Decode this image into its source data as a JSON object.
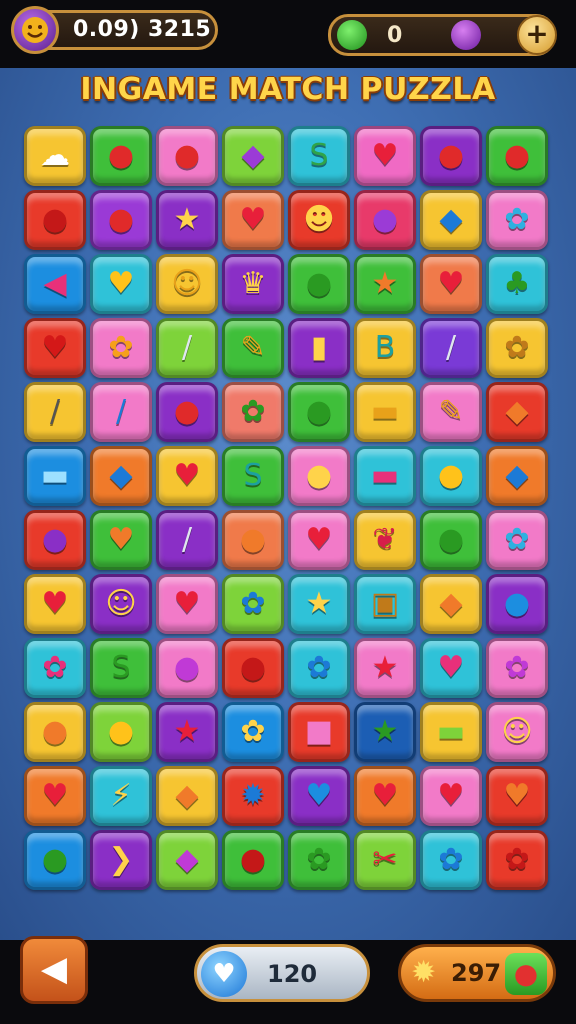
{
  "header": {
    "avatar_icon": "smiley-face-icon",
    "score_text": "0.09) 3215",
    "gems_count": "0",
    "gem_icons": [
      "green-gem-icon",
      "purple-gem-icon"
    ],
    "add_label": "+"
  },
  "title": "INGAME MATCH PUZZLA",
  "grid": {
    "columns": 8,
    "rows": [
      [
        {
          "color": "#f6c531",
          "icon": "☁",
          "ic": "#ffffff",
          "name": "cloud-face-icon"
        },
        {
          "color": "#3fbf3a",
          "icon": "●",
          "ic": "#e02a2a",
          "name": "apple-icon"
        },
        {
          "color": "#f27ac8",
          "icon": "●",
          "ic": "#e02a2a",
          "name": "apple-icon"
        },
        {
          "color": "#7ed33a",
          "icon": "◆",
          "ic": "#9b3bd6",
          "name": "block-icon"
        },
        {
          "color": "#2fc2d8",
          "icon": "S",
          "ic": "#2fa34a",
          "name": "worm-icon"
        },
        {
          "color": "#f06ac4",
          "icon": "♥",
          "ic": "#e81f3a",
          "name": "heart-icon"
        },
        {
          "color": "#8a2fc6",
          "icon": "●",
          "ic": "#e02a2a",
          "name": "apple-icon"
        },
        {
          "color": "#3fbf3a",
          "icon": "●",
          "ic": "#e02a2a",
          "name": "ball-icon"
        }
      ],
      [
        {
          "color": "#e83a2a",
          "icon": "●",
          "ic": "#c41818",
          "name": "apple-icon"
        },
        {
          "color": "#9a3ad6",
          "icon": "●",
          "ic": "#e02a2a",
          "name": "apple-icon"
        },
        {
          "color": "#8a2fc6",
          "icon": "★",
          "ic": "#ffd34a",
          "name": "star-icon"
        },
        {
          "color": "#f07a4a",
          "icon": "♥",
          "ic": "#e81f3a",
          "name": "heart-icon"
        },
        {
          "color": "#e83a2a",
          "icon": "☻",
          "ic": "#ffd34a",
          "name": "face-icon"
        },
        {
          "color": "#e83a6a",
          "icon": "●",
          "ic": "#9b3bd6",
          "name": "apple-icon"
        },
        {
          "color": "#f6c531",
          "icon": "◆",
          "ic": "#1c7ad6",
          "name": "pencil-icon"
        },
        {
          "color": "#f27ac8",
          "icon": "✿",
          "ic": "#2fb0e0",
          "name": "flower-icon"
        }
      ],
      [
        {
          "color": "#1c8ee0",
          "icon": "◀",
          "ic": "#e8307a",
          "name": "arrow-icon"
        },
        {
          "color": "#2fc2d8",
          "icon": "♥",
          "ic": "#ffc21a",
          "name": "heart-icon"
        },
        {
          "color": "#f6c531",
          "icon": "☺",
          "ic": "#e8a11a",
          "name": "smiley-icon"
        },
        {
          "color": "#8a2fc6",
          "icon": "♛",
          "ic": "#ffd34a",
          "name": "crown-icon"
        },
        {
          "color": "#3fbf3a",
          "icon": "●",
          "ic": "#2a9a22",
          "name": "apple-icon"
        },
        {
          "color": "#3fbf3a",
          "icon": "★",
          "ic": "#f07a2a",
          "name": "star-icon"
        },
        {
          "color": "#f07a4a",
          "icon": "♥",
          "ic": "#e81f3a",
          "name": "heart-icon"
        },
        {
          "color": "#2fc2d8",
          "icon": "♣",
          "ic": "#2a9a22",
          "name": "tree-icon"
        }
      ],
      [
        {
          "color": "#e83a2a",
          "icon": "♥",
          "ic": "#d41818",
          "name": "heart-icon"
        },
        {
          "color": "#f27ac8",
          "icon": "✿",
          "ic": "#f6a01a",
          "name": "gear-icon"
        },
        {
          "color": "#7ed33a",
          "icon": "/",
          "ic": "#dfe6ee",
          "name": "crayon-icon"
        },
        {
          "color": "#3fbf3a",
          "icon": "✎",
          "ic": "#e8a11a",
          "name": "brush-icon"
        },
        {
          "color": "#8a2fc6",
          "icon": "▮",
          "ic": "#ffd34a",
          "name": "crayon-icon"
        },
        {
          "color": "#f6c531",
          "icon": "B",
          "ic": "#1ca0a0",
          "name": "block-icon"
        },
        {
          "color": "#7a3ad6",
          "icon": "/",
          "ic": "#dfe6ee",
          "name": "crayon-icon"
        },
        {
          "color": "#f6c531",
          "icon": "✿",
          "ic": "#c07a1a",
          "name": "gear-icon"
        }
      ],
      [
        {
          "color": "#f6c531",
          "icon": "/",
          "ic": "#555555",
          "name": "crayon-icon"
        },
        {
          "color": "#f27ac8",
          "icon": "/",
          "ic": "#1c7ad6",
          "name": "crayon-icon"
        },
        {
          "color": "#8a2fc6",
          "icon": "●",
          "ic": "#e02a2a",
          "name": "blob-icon"
        },
        {
          "color": "#f07a6a",
          "icon": "✿",
          "ic": "#2a9a22",
          "name": "splat-icon"
        },
        {
          "color": "#3fbf3a",
          "icon": "●",
          "ic": "#2a9a22",
          "name": "blob-icon"
        },
        {
          "color": "#f6c531",
          "icon": "▬",
          "ic": "#e8a11a",
          "name": "eraser-icon"
        },
        {
          "color": "#f27ac8",
          "icon": "✎",
          "ic": "#e8a11a",
          "name": "pencil-icon"
        },
        {
          "color": "#e83a2a",
          "icon": "◆",
          "ic": "#f07a2a",
          "name": "leaf-icon"
        }
      ],
      [
        {
          "color": "#1c8ee0",
          "icon": "▬",
          "ic": "#9ee0ff",
          "name": "eraser-icon"
        },
        {
          "color": "#f07a2a",
          "icon": "◆",
          "ic": "#1c7ad6",
          "name": "diamond-icon"
        },
        {
          "color": "#f6c531",
          "icon": "♥",
          "ic": "#e81f3a",
          "name": "heart-icon"
        },
        {
          "color": "#3fbf3a",
          "icon": "S",
          "ic": "#1ca0a0",
          "name": "worm-icon"
        },
        {
          "color": "#f27ac8",
          "icon": "●",
          "ic": "#ffd34a",
          "name": "hexagon-icon"
        },
        {
          "color": "#2fc2d8",
          "icon": "▬",
          "ic": "#e8307a",
          "name": "ruler-icon"
        },
        {
          "color": "#2fc2d8",
          "icon": "●",
          "ic": "#ffc21a",
          "name": "ball-icon"
        },
        {
          "color": "#f07a2a",
          "icon": "◆",
          "ic": "#1c7ad6",
          "name": "diamond-icon"
        }
      ],
      [
        {
          "color": "#e83a2a",
          "icon": "●",
          "ic": "#8a2fc6",
          "name": "blob-icon"
        },
        {
          "color": "#3fbf3a",
          "icon": "♥",
          "ic": "#f07a2a",
          "name": "heart-icon"
        },
        {
          "color": "#8a2fc6",
          "icon": "/",
          "ic": "#dfe6ee",
          "name": "crayon-icon"
        },
        {
          "color": "#f07a4a",
          "icon": "●",
          "ic": "#f07a2a",
          "name": "blob-icon"
        },
        {
          "color": "#f27ac8",
          "icon": "♥",
          "ic": "#e81f3a",
          "name": "heart-icon"
        },
        {
          "color": "#f6c531",
          "icon": "❦",
          "ic": "#d61e4a",
          "name": "strawberry-icon"
        },
        {
          "color": "#3fbf3a",
          "icon": "●",
          "ic": "#2a9a22",
          "name": "apple-icon"
        },
        {
          "color": "#f27ac8",
          "icon": "✿",
          "ic": "#2fb0e0",
          "name": "flower-icon"
        }
      ],
      [
        {
          "color": "#f6c531",
          "icon": "♥",
          "ic": "#e81f3a",
          "name": "heart-icon"
        },
        {
          "color": "#8a2fc6",
          "icon": "☺",
          "ic": "#ffd34a",
          "name": "smiley-icon"
        },
        {
          "color": "#f27ac8",
          "icon": "♥",
          "ic": "#e81f3a",
          "name": "heart-icon"
        },
        {
          "color": "#7ed33a",
          "icon": "✿",
          "ic": "#1c7ad6",
          "name": "flower-icon"
        },
        {
          "color": "#2fc2d8",
          "icon": "★",
          "ic": "#ffd34a",
          "name": "house-icon"
        },
        {
          "color": "#2fc2d8",
          "icon": "▣",
          "ic": "#c07a1a",
          "name": "robot-icon"
        },
        {
          "color": "#f6c531",
          "icon": "◆",
          "ic": "#f07a2a",
          "name": "carrot-icon"
        },
        {
          "color": "#8a2fc6",
          "icon": "●",
          "ic": "#1c8ee0",
          "name": "ball-icon"
        }
      ],
      [
        {
          "color": "#2fc2d8",
          "icon": "✿",
          "ic": "#e8307a",
          "name": "flower-icon"
        },
        {
          "color": "#3fbf3a",
          "icon": "S",
          "ic": "#2a9a22",
          "name": "worm-icon"
        },
        {
          "color": "#f27ac8",
          "icon": "●",
          "ic": "#c03ad6",
          "name": "blob-icon"
        },
        {
          "color": "#e83a2a",
          "icon": "●",
          "ic": "#c41818",
          "name": "apple-icon"
        },
        {
          "color": "#2fc2d8",
          "icon": "✿",
          "ic": "#1c7ad6",
          "name": "gear-icon"
        },
        {
          "color": "#f27ac8",
          "icon": "★",
          "ic": "#e81f3a",
          "name": "star-icon"
        },
        {
          "color": "#2fc2d8",
          "icon": "♥",
          "ic": "#e8307a",
          "name": "heart-icon"
        },
        {
          "color": "#f27ac8",
          "icon": "✿",
          "ic": "#c03ad6",
          "name": "flower-icon"
        }
      ],
      [
        {
          "color": "#f6c531",
          "icon": "●",
          "ic": "#f07a2a",
          "name": "orange-icon"
        },
        {
          "color": "#7ed33a",
          "icon": "●",
          "ic": "#ffc21a",
          "name": "ball-icon"
        },
        {
          "color": "#8a2fc6",
          "icon": "★",
          "ic": "#e81f3a",
          "name": "star-icon"
        },
        {
          "color": "#1c8ee0",
          "icon": "✿",
          "ic": "#ffd34a",
          "name": "gear-icon"
        },
        {
          "color": "#e83a2a",
          "icon": "■",
          "ic": "#f27ac8",
          "name": "box-icon"
        },
        {
          "color": "#1c5eb4",
          "icon": "★",
          "ic": "#2a9a22",
          "name": "star-icon"
        },
        {
          "color": "#f6c531",
          "icon": "▬",
          "ic": "#7ed33a",
          "name": "ruler-icon"
        },
        {
          "color": "#f27ac8",
          "icon": "☺",
          "ic": "#ffd34a",
          "name": "bear-icon"
        }
      ],
      [
        {
          "color": "#f07a2a",
          "icon": "♥",
          "ic": "#e81f3a",
          "name": "heart-icon"
        },
        {
          "color": "#2fc2d8",
          "icon": "⚡",
          "ic": "#ffd34a",
          "name": "lightning-icon"
        },
        {
          "color": "#f6c531",
          "icon": "◆",
          "ic": "#f07a2a",
          "name": "leaf-icon"
        },
        {
          "color": "#e83a2a",
          "icon": "✹",
          "ic": "#1c7ad6",
          "name": "spiky-icon"
        },
        {
          "color": "#8a2fc6",
          "icon": "♥",
          "ic": "#1c8ee0",
          "name": "heart-icon"
        },
        {
          "color": "#f07a2a",
          "icon": "♥",
          "ic": "#e81f3a",
          "name": "heart-icon"
        },
        {
          "color": "#f27ac8",
          "icon": "♥",
          "ic": "#e81f3a",
          "name": "heart-icon"
        },
        {
          "color": "#e83a2a",
          "icon": "♥",
          "ic": "#f07a2a",
          "name": "heart-icon"
        }
      ],
      [
        {
          "color": "#1c8ee0",
          "icon": "●",
          "ic": "#2a9a22",
          "name": "blob-icon"
        },
        {
          "color": "#8a2fc6",
          "icon": "❯",
          "ic": "#ffd34a",
          "name": "chevron-right-icon"
        },
        {
          "color": "#7ed33a",
          "icon": "◆",
          "ic": "#c03ad6",
          "name": "block-icon"
        },
        {
          "color": "#3fbf3a",
          "icon": "●",
          "ic": "#c41818",
          "name": "apple-icon"
        },
        {
          "color": "#3fbf3a",
          "icon": "✿",
          "ic": "#2a9a22",
          "name": "splat-icon"
        },
        {
          "color": "#7ed33a",
          "icon": "✂",
          "ic": "#e81f3a",
          "name": "scissors-icon"
        },
        {
          "color": "#2fc2d8",
          "icon": "✿",
          "ic": "#1c7ad6",
          "name": "splat-icon"
        },
        {
          "color": "#e83a2a",
          "icon": "✿",
          "ic": "#c41818",
          "name": "gear-icon"
        }
      ]
    ]
  },
  "footer": {
    "back_icon": "back-arrow-icon",
    "lives_icon": "heart-icon",
    "lives_value": "120",
    "coins_icon": "coin-icon",
    "coins_value": "297",
    "coins_add_icon": "apple-icon"
  }
}
